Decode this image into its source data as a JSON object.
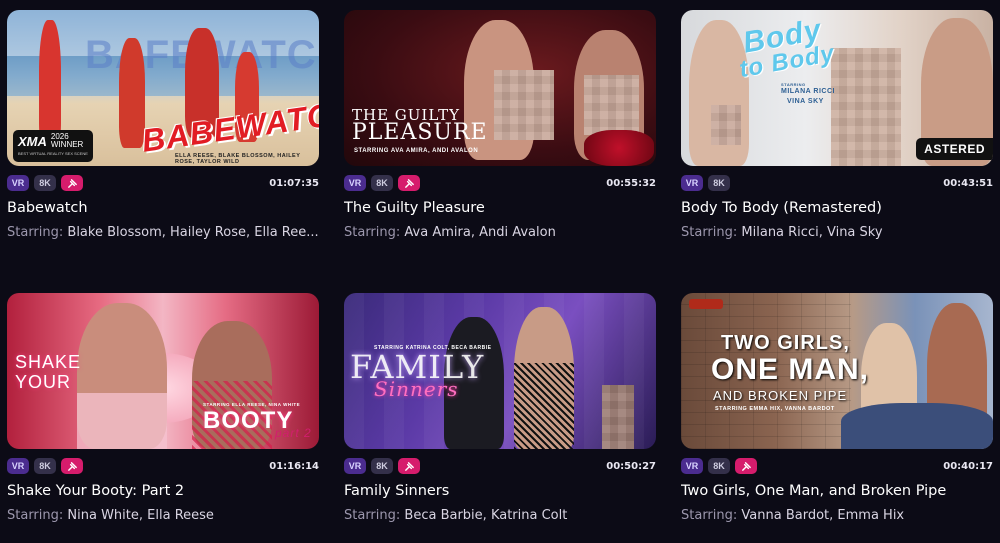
{
  "starring_label": "Starring:",
  "tags": {
    "vr": "VR",
    "k8": "8K"
  },
  "colors": {
    "background": "#0c0b16",
    "vr_tag": "#4b2c8f",
    "k8_tag": "#34304a",
    "pin_tag": "#d61c6c"
  },
  "icons": {
    "pin_tag": "pin-icon"
  },
  "cards": [
    {
      "title": "Babewatch",
      "duration": "01:07:35",
      "has_pin": true,
      "starring": [
        "Blake Blossom",
        "Hailey Rose",
        "Ella Ree..."
      ],
      "thumb": {
        "big_text": "BAFEWATCH",
        "logo_text": "BABEWATCH",
        "sub_text": "ELLA REESE, BLAKE BLOSSOM, HAILEY ROSE, TAYLOR WILD",
        "badge_year": "2026",
        "badge_word": "WINNER",
        "badge_caption": "BEST VIRTUAL REALITY SEX SCENE"
      }
    },
    {
      "title": "The Guilty Pleasure",
      "duration": "00:55:32",
      "has_pin": true,
      "starring": [
        "Ava Amira",
        "Andi Avalon"
      ],
      "thumb": {
        "big_text_1": "THE GUILTY",
        "big_text_2": "PLEASURE",
        "sub_text": "STARRING  AVA AMIRA, ANDI AVALON"
      }
    },
    {
      "title": "Body To Body (Remastered)",
      "duration": "00:43:51",
      "has_pin": false,
      "starring": [
        "Milana Ricci",
        "Vina Sky"
      ],
      "thumb": {
        "big_text_1": "Body",
        "big_text_2": "to Body",
        "sub_label": "STARRING",
        "sub_text_1": "MILANA RICCI",
        "sub_text_2": "VINA SKY",
        "corner_text": "ASTERED"
      }
    },
    {
      "title": "Shake Your Booty: Part 2",
      "duration": "01:16:14",
      "has_pin": true,
      "starring": [
        "Nina White",
        "Ella Reese"
      ],
      "thumb": {
        "big_text_1": "SHAKE",
        "big_text_2": "YOUR",
        "big_text_3": "BOOTY",
        "part_text": "part 2",
        "sub_text": "STARRING ELLA REESE, NINA WHITE"
      }
    },
    {
      "title": "Family Sinners",
      "duration": "00:50:27",
      "has_pin": true,
      "starring": [
        "Beca Barbie",
        "Katrina Colt"
      ],
      "thumb": {
        "big_text_1": "FAMILY",
        "big_text_2": "Sinners",
        "sub_text": "STARRING KATRINA COLT, BECA BARBIE"
      }
    },
    {
      "title": "Two Girls, One Man, and Broken Pipe",
      "duration": "00:40:17",
      "has_pin": true,
      "starring": [
        "Vanna Bardot",
        "Emma Hix"
      ],
      "thumb": {
        "big_text_1": "TWO GIRLS,",
        "big_text_2": "ONE MAN,",
        "big_text_3": "AND BROKEN PIPE",
        "sub_text": "STARRING  EMMA HIX, VANNA BARDOT"
      }
    }
  ]
}
